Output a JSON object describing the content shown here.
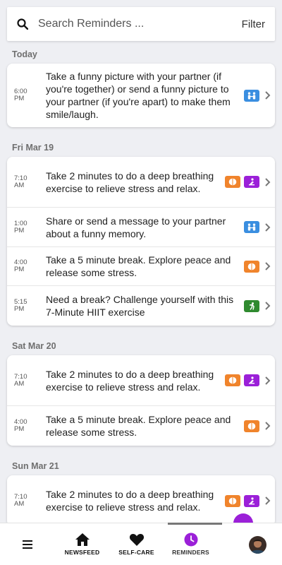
{
  "search": {
    "placeholder": "Search Reminders ...",
    "filter_label": "Filter"
  },
  "colors": {
    "brain": "#f0842c",
    "meditate": "#9b20d8",
    "partner": "#3a8ee0",
    "exercise": "#2f8a2f",
    "active_nav": "#9b20d8"
  },
  "days": [
    {
      "label": "Today",
      "items": [
        {
          "time": "6:00",
          "ampm": "PM",
          "text": "Take a funny picture with your partner (if you're together) or send a funny picture to your partner (if you're apart) to make them smile/laugh.",
          "icons": [
            "partner-icon"
          ]
        }
      ]
    },
    {
      "label": "Fri Mar 19",
      "items": [
        {
          "time": "7:10",
          "ampm": "AM",
          "text": "Take 2 minutes to do a deep breathing exercise to relieve stress and relax.",
          "icons": [
            "brain-icon",
            "meditation-icon"
          ]
        },
        {
          "time": "1:00",
          "ampm": "PM",
          "text": "Share or send a message to your partner about a funny memory.",
          "icons": [
            "partner-icon"
          ]
        },
        {
          "time": "4:00",
          "ampm": "PM",
          "text": "Take a 5 minute break. Explore peace and release some stress.",
          "icons": [
            "brain-icon"
          ]
        },
        {
          "time": "5:15",
          "ampm": "PM",
          "text": "Need a break? Challenge yourself with this 7-Minute HIIT exercise",
          "icons": [
            "exercise-icon"
          ]
        }
      ]
    },
    {
      "label": "Sat Mar 20",
      "items": [
        {
          "time": "7:10",
          "ampm": "AM",
          "text": "Take 2 minutes to do a deep breathing exercise to relieve stress and relax.",
          "icons": [
            "brain-icon",
            "meditation-icon"
          ]
        },
        {
          "time": "4:00",
          "ampm": "PM",
          "text": "Take a 5 minute break. Explore peace and release some stress.",
          "icons": [
            "brain-icon"
          ]
        }
      ]
    },
    {
      "label": "Sun Mar 21",
      "items": [
        {
          "time": "7:10",
          "ampm": "AM",
          "text": "Take 2 minutes to do a deep breathing exercise to relieve stress and relax.",
          "icons": [
            "brain-icon",
            "meditation-icon"
          ]
        }
      ]
    }
  ],
  "nav": {
    "newsfeed": "NEWSFEED",
    "selfcare": "SELF-CARE",
    "reminders": "REMINDERS"
  }
}
